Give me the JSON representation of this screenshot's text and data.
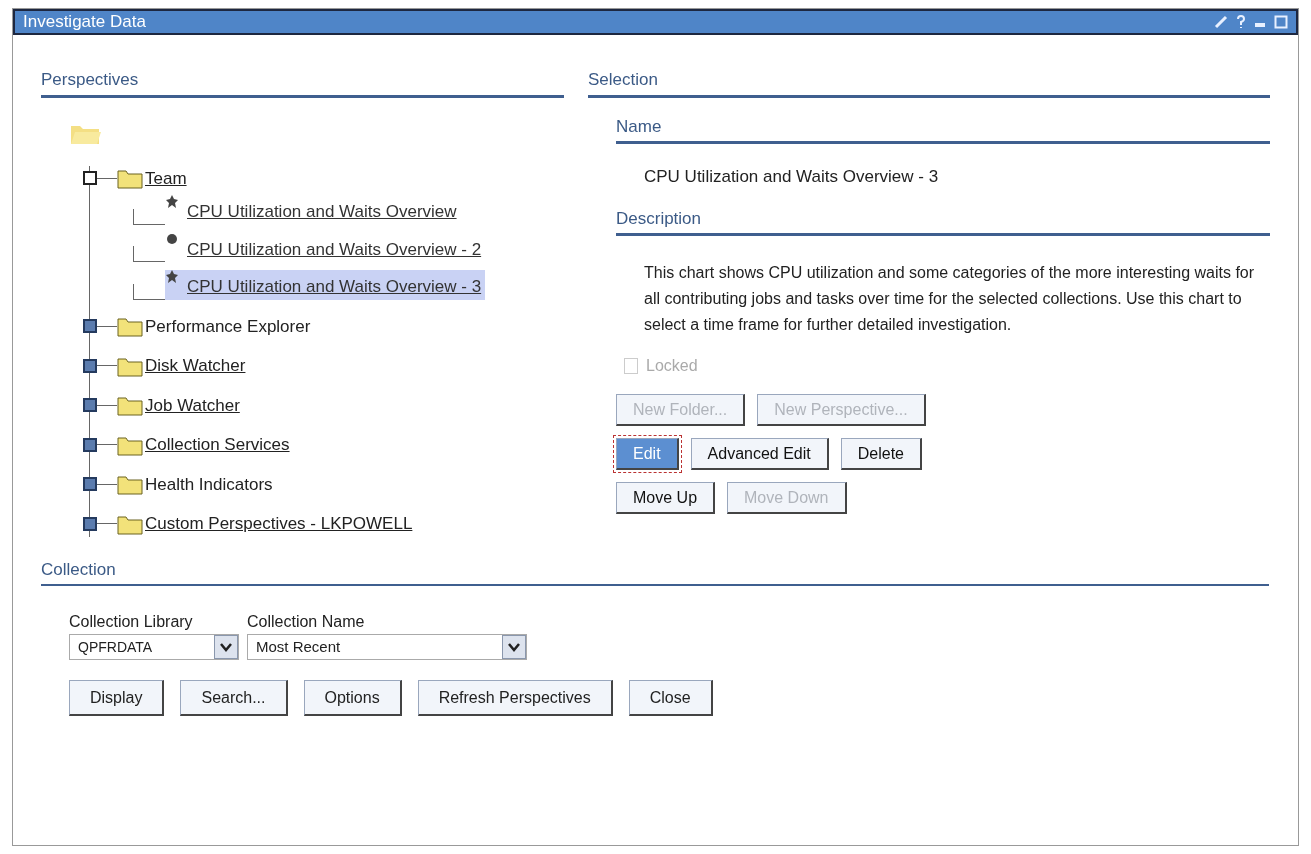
{
  "window": {
    "title": "Investigate Data"
  },
  "perspectives": {
    "heading": "Perspectives",
    "tree": [
      {
        "label": "Team",
        "expanded": true,
        "link": true,
        "children": [
          {
            "label": "CPU Utilization and Waits Overview",
            "kind": "star",
            "selected": false
          },
          {
            "label": "CPU Utilization and Waits Overview - 2",
            "kind": "dot",
            "selected": false
          },
          {
            "label": "CPU Utilization and Waits Overview - 3",
            "kind": "star",
            "selected": true
          }
        ]
      },
      {
        "label": "Performance Explorer",
        "expanded": false,
        "link": false
      },
      {
        "label": "Disk Watcher",
        "expanded": false,
        "link": true
      },
      {
        "label": "Job Watcher",
        "expanded": false,
        "link": true
      },
      {
        "label": "Collection Services",
        "expanded": false,
        "link": true
      },
      {
        "label": "Health Indicators",
        "expanded": false,
        "link": false
      },
      {
        "label": "Custom Perspectives - LKPOWELL",
        "expanded": false,
        "link": true
      }
    ]
  },
  "selection": {
    "heading": "Selection",
    "name_heading": "Name",
    "name": "CPU Utilization and Waits Overview - 3",
    "description_heading": "Description",
    "description": "This chart shows CPU utilization and some categories of the more interesting waits for all contributing jobs and tasks over time for the selected collections. Use this chart to select a time frame for further detailed investigation.",
    "locked": {
      "label": "Locked",
      "checked": false,
      "disabled": true
    },
    "button_rows": [
      [
        {
          "label": "New Folder...",
          "disabled": true,
          "focused": false
        },
        {
          "label": "New Perspective...",
          "disabled": true,
          "focused": false
        }
      ],
      [
        {
          "label": "Edit",
          "disabled": false,
          "focused": true
        },
        {
          "label": "Advanced Edit",
          "disabled": false,
          "focused": false
        },
        {
          "label": "Delete",
          "disabled": false,
          "focused": false
        }
      ],
      [
        {
          "label": "Move Up",
          "disabled": false,
          "focused": false
        },
        {
          "label": "Move Down",
          "disabled": true,
          "focused": false
        }
      ]
    ]
  },
  "collection": {
    "heading": "Collection",
    "library": {
      "label": "Collection Library",
      "value": "QPFRDATA"
    },
    "name": {
      "label": "Collection Name",
      "value": "Most Recent"
    }
  },
  "buttons": [
    "Display",
    "Search...",
    "Options",
    "Refresh Perspectives",
    "Close"
  ]
}
